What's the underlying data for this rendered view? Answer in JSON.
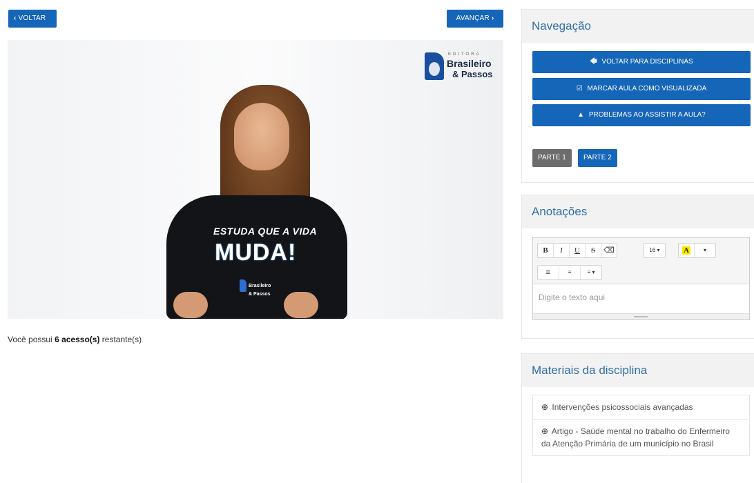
{
  "top_nav": {
    "back_icon": "chevron-left-icon",
    "back_label": "VOLTAR",
    "next_label": "AVANÇAR",
    "next_icon": "chevron-right-icon"
  },
  "video": {
    "brand_small": "EDITORA",
    "brand_line1": "Brasileiro",
    "brand_line2": "& Passos",
    "shirt_line1": "ESTUDA QUE A VIDA",
    "shirt_line2": "MUDA!",
    "shirt_logo_line1": "Brasileiro",
    "shirt_logo_line2": "& Passos"
  },
  "access": {
    "prefix": "Você possui",
    "count": "6 acesso(s)",
    "suffix": "restante(s)"
  },
  "navigation": {
    "title": "Navegação",
    "buttons": [
      {
        "icon": "arrow-left-icon",
        "glyph": "🡄",
        "label": "VOLTAR PARA DISCIPLINAS"
      },
      {
        "icon": "check-square-icon",
        "glyph": "☑",
        "label": "MARCAR AULA COMO VISUALIZADA"
      },
      {
        "icon": "warning-icon",
        "glyph": "▲",
        "label": "PROBLEMAS AO ASSISTIR A AULA?"
      }
    ],
    "parts": [
      {
        "label": "PARTE 1",
        "active": true
      },
      {
        "label": "PARTE 2",
        "active": false
      }
    ]
  },
  "notes": {
    "title": "Anotações",
    "toolbar": {
      "bold": "B",
      "italic": "I",
      "underline": "U",
      "strike": "S",
      "eraser": "⌫",
      "font_size": "16 ▾",
      "highlight": "A",
      "highlight_caret": "▾",
      "ul": "☰",
      "ol": "≡",
      "align": "≡ ▾"
    },
    "placeholder": "Digite o texto aqui"
  },
  "materials": {
    "title": "Materiais da disciplina",
    "download_icon": "download-circle-icon",
    "items": [
      {
        "label": "Intervenções psicossociais avançadas"
      },
      {
        "label": "Artigo - Saúde mental no trabalho do Enfermeiro da Atenção Primária de um município no Brasil"
      }
    ]
  }
}
